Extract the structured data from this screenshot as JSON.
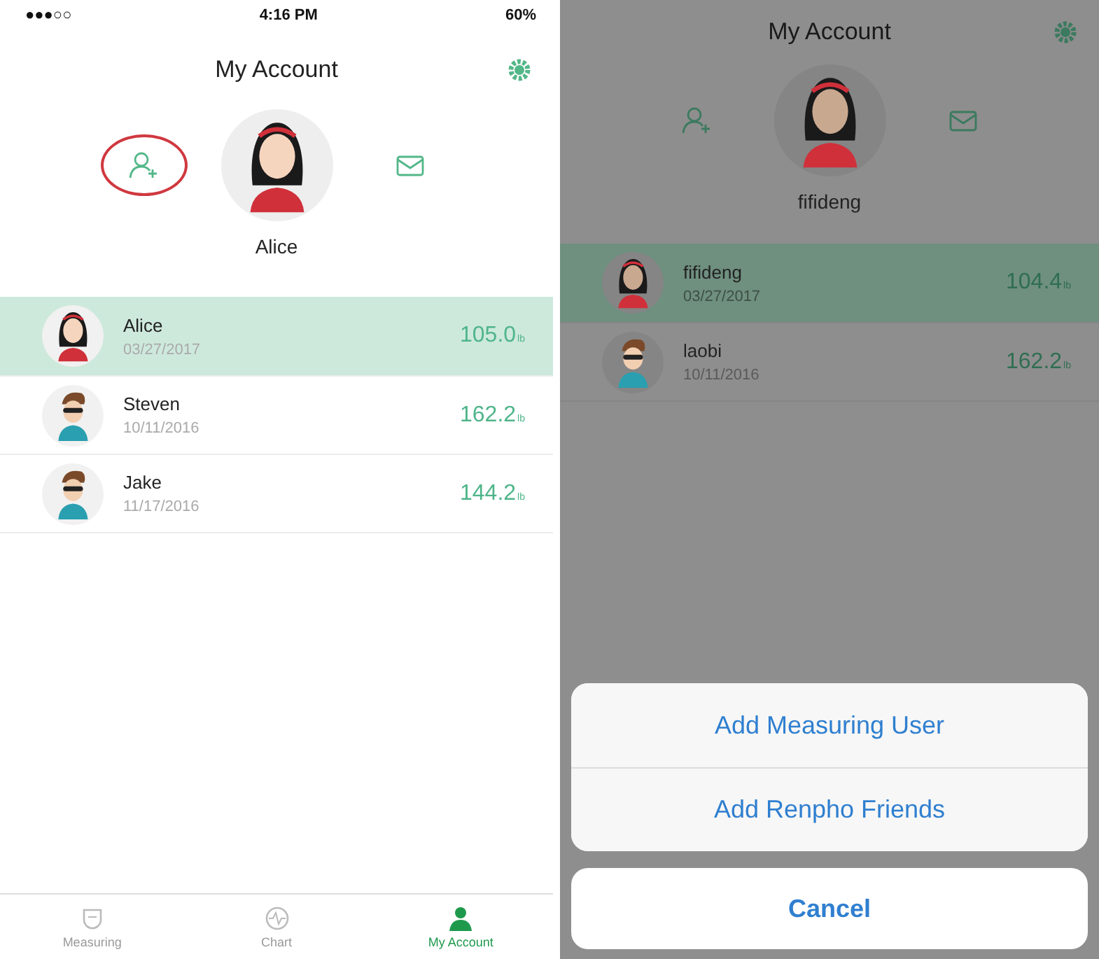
{
  "left_screen": {
    "dimmed": false,
    "status_bar": {
      "carrier": "●●●○○",
      "time": "4:16 PM",
      "battery": "60%"
    },
    "title": "My Account",
    "profile": {
      "name": "Alice",
      "kind": "female",
      "add_user_highlighted": true
    },
    "users": [
      {
        "name": "Alice",
        "date": "03/27/2017",
        "weight": "105.0",
        "unit": "lb",
        "kind": "female",
        "selected": true
      },
      {
        "name": "Steven",
        "date": "10/11/2016",
        "weight": "162.2",
        "unit": "lb",
        "kind": "male",
        "selected": false
      },
      {
        "name": "Jake",
        "date": "11/17/2016",
        "weight": "144.2",
        "unit": "lb",
        "kind": "male",
        "selected": false
      }
    ],
    "tabs": [
      {
        "label": "Measuring",
        "kind": "scale",
        "selected": false
      },
      {
        "label": "Chart",
        "kind": "chart",
        "selected": false
      },
      {
        "label": "My Account",
        "kind": "person",
        "selected": true
      }
    ]
  },
  "right_screen": {
    "dimmed": true,
    "title": "My Account",
    "profile": {
      "name": "fifideng",
      "kind": "female",
      "add_user_highlighted": false
    },
    "users": [
      {
        "name": "fifideng",
        "date": "03/27/2017",
        "weight": "104.4",
        "unit": "lb",
        "kind": "female",
        "selected": true
      },
      {
        "name": "laobi",
        "date": "10/11/2016",
        "weight": "162.2",
        "unit": "lb",
        "kind": "male",
        "selected": false
      }
    ],
    "action_sheet": {
      "options": [
        "Add Measuring User",
        "Add Renpho Friends"
      ],
      "cancel": "Cancel"
    }
  }
}
